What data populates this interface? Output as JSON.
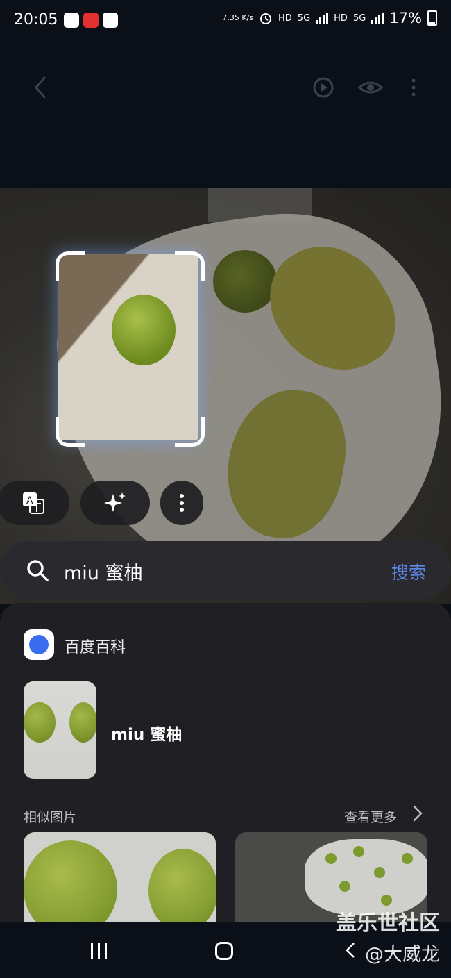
{
  "status_bar": {
    "time": "20:05",
    "net_speed": "7.35 K/s",
    "hd1": "HD",
    "net1": "5G",
    "hd2": "HD",
    "net2": "5G",
    "battery": "17%"
  },
  "top_bar": {
    "icons": [
      "back-icon",
      "motion-photo-icon",
      "eye-icon",
      "more-vertical-icon"
    ]
  },
  "actions": {
    "icons": [
      "translate-icon",
      "sparkle-icon",
      "more-vertical-icon"
    ]
  },
  "search": {
    "query": "miu 蜜柚",
    "button": "搜索"
  },
  "result": {
    "source": "百度百科",
    "title": "miu 蜜柚"
  },
  "similar": {
    "label": "相似图片",
    "see_more": "查看更多"
  },
  "watermark": {
    "line1": "盖乐世社区",
    "line2": "@大威龙"
  },
  "colors": {
    "accent": "#5c86e8",
    "panel": "#202024",
    "background": "#0b1018"
  }
}
